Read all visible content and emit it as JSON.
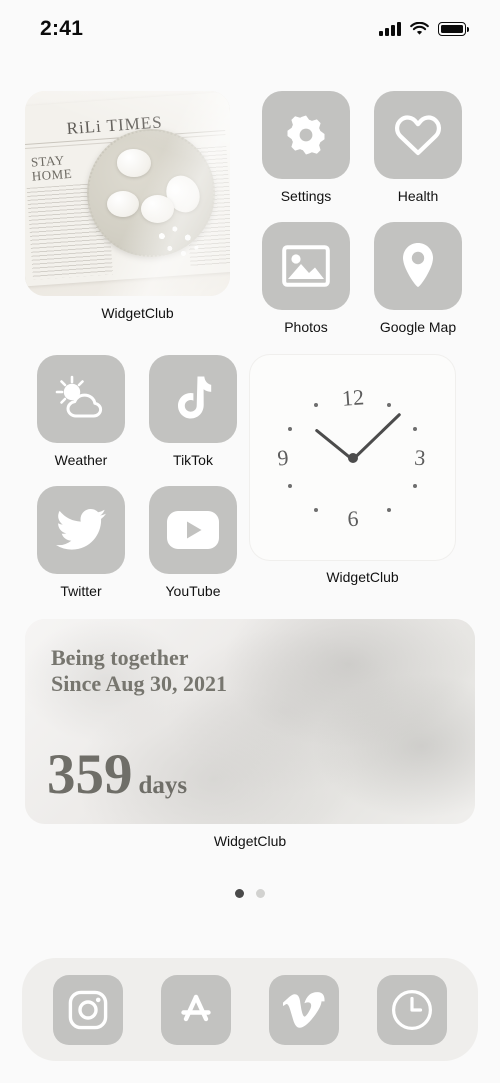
{
  "status_bar": {
    "time": "2:41",
    "signal_icon": "cellular-signal-icon",
    "wifi_icon": "wifi-icon",
    "battery_icon": "battery-full-icon"
  },
  "theme": {
    "background": "#fafafa",
    "tile_gray": "#c2c2c0",
    "icon_white": "#ffffff",
    "label_dark": "#121212",
    "dock_bg": "#efeeec"
  },
  "photo_widget": {
    "label": "WidgetClub",
    "masthead": "RiLi  TIMES",
    "headline_line1": "STAY",
    "headline_line2": "HOME"
  },
  "apps_top_right": [
    {
      "label": "Settings",
      "icon": "gear-icon"
    },
    {
      "label": "Health",
      "icon": "heart-outline-icon"
    },
    {
      "label": "Photos",
      "icon": "photo-image-icon"
    },
    {
      "label": "Google Map",
      "icon": "map-pin-icon"
    }
  ],
  "apps_mid_left": [
    {
      "label": "Weather",
      "icon": "sun-cloud-icon"
    },
    {
      "label": "TikTok",
      "icon": "tiktok-note-icon"
    },
    {
      "label": "Twitter",
      "icon": "twitter-bird-icon"
    },
    {
      "label": "YouTube",
      "icon": "youtube-play-icon"
    }
  ],
  "clock_widget": {
    "label": "WidgetClub",
    "numbers": {
      "twelve": "12",
      "three": "3",
      "six": "6",
      "nine": "9"
    },
    "hour_hand_deg": 219,
    "minute_hand_deg": -44
  },
  "countdown_widget": {
    "label": "WidgetClub",
    "title_line1": "Being together",
    "title_line2": "Since Aug 30, 2021",
    "days_count": "359",
    "days_unit": "days"
  },
  "page_dots": {
    "total": 2,
    "active_index": 0
  },
  "dock": [
    {
      "name": "Instagram",
      "icon": "instagram-camera-icon"
    },
    {
      "name": "App Store",
      "icon": "app-store-icon"
    },
    {
      "name": "Vimeo",
      "icon": "vimeo-icon"
    },
    {
      "name": "Clock",
      "icon": "clock-face-icon"
    }
  ]
}
